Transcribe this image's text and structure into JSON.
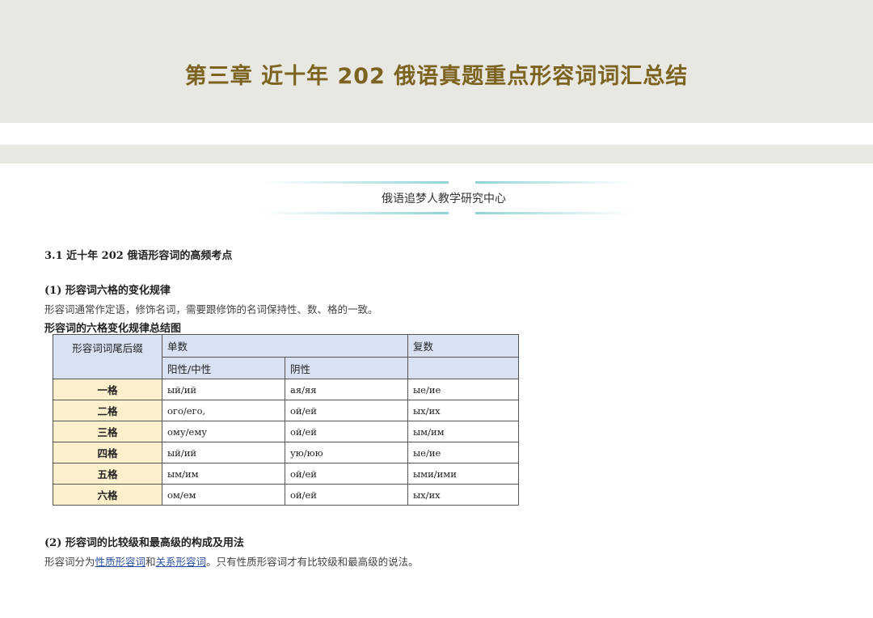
{
  "header": {
    "title": "第三章  近十年 202 俄语真题重点形容词词汇总结"
  },
  "banner": {
    "center_name": "俄语追梦人教学研究中心"
  },
  "section": {
    "heading": "3.1  近十年 202 俄语形容词的高频考点"
  },
  "part1": {
    "heading": "(1)   形容词六格的变化规律",
    "text": "形容词通常作定语，修饰名词，需要跟修饰的名词保持性、数、格的一致。",
    "table_caption": "形容词的六格变化规律总结图"
  },
  "table": {
    "suffix_header": "形容词词尾后缀",
    "singular_header": "单数",
    "plural_header": "复数",
    "masc_neut_header": "阳性/中性",
    "fem_header": "阴性",
    "rows": [
      {
        "case": "一格",
        "masc": "ый/ий",
        "fem": "ая/яя",
        "plural": "ые/ие"
      },
      {
        "case": "二格",
        "masc": "ого/его,",
        "fem": "ой/ей",
        "plural": "ых/их"
      },
      {
        "case": "三格",
        "masc": "ому/ему",
        "fem": "ой/ей",
        "plural": "ым/им"
      },
      {
        "case": "四格",
        "masc": "ый/ий",
        "fem": "ую/юю",
        "plural": "ые/ие"
      },
      {
        "case": "五格",
        "masc": "ым/им",
        "fem": "ой/ей",
        "plural": "ыми/ими"
      },
      {
        "case": "六格",
        "masc": "ом/ем",
        "fem": "ой/ей",
        "plural": "ых/их"
      }
    ]
  },
  "part2": {
    "heading": "(2)   形容词的比较级和最高级的构成及用法",
    "text_prefix": "形容词分为",
    "link1": "性质形容词",
    "text_and": "和",
    "link2": "关系形容词",
    "text_suffix": "。只有性质形容词才有比较级和最高级的说法。"
  }
}
